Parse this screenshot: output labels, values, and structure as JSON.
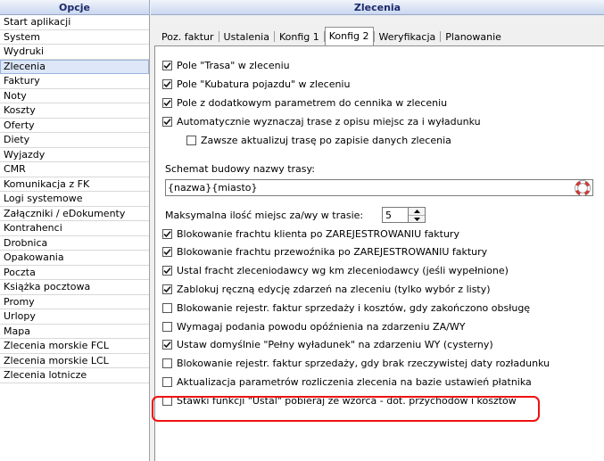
{
  "left_header": "Opcje",
  "right_header": "Zlecenia",
  "sidebar": {
    "items": [
      "Start aplikacji",
      "System",
      "Wydruki",
      "Zlecenia",
      "Faktury",
      "Noty",
      "Koszty",
      "Oferty",
      "Diety",
      "Wyjazdy",
      "CMR",
      "Komunikacja z FK",
      "Logi systemowe",
      "Załączniki / eDokumenty",
      "Kontrahenci",
      "Drobnica",
      "Opakowania",
      "Poczta",
      "Książka pocztowa",
      "Promy",
      "Urlopy",
      "Mapa",
      "Zlecenia morskie FCL",
      "Zlecenia morskie LCL",
      "Zlecenia lotnicze"
    ],
    "selected": "Zlecenia"
  },
  "tabs": [
    "Poz. faktur",
    "Ustalenia",
    "Konfig 1",
    "Konfig 2",
    "Weryfikacja",
    "Planowanie"
  ],
  "active_tab": "Konfig 2",
  "options_top": [
    {
      "label": "Pole \"Trasa\" w zleceniu",
      "checked": true
    },
    {
      "label": "Pole \"Kubatura pojazdu\" w zleceniu",
      "checked": true
    },
    {
      "label": "Pole z dodatkowym parametrem do cennika w zleceniu",
      "checked": true
    },
    {
      "label": "Automatycznie wyznaczaj trase z opisu miejsc za i wyładunku",
      "checked": true
    },
    {
      "label": "Zawsze aktualizuj trasę po zapisie danych zlecenia",
      "checked": false
    }
  ],
  "route_schema": {
    "label": "Schemat budowy nazwy trasy:",
    "value": "{nazwa}{miasto}"
  },
  "max_places": {
    "label": "Maksymalna ilość miejsc za/wy w trasie:",
    "value": "5"
  },
  "options_bottom": [
    {
      "label": "Blokowanie frachtu klienta po ZAREJESTROWANIU faktury",
      "checked": true
    },
    {
      "label": "Blokowanie frachtu przewoźnika po ZAREJESTROWANIU faktury",
      "checked": true
    },
    {
      "label": "Ustal fracht zleceniodawcy wg km zleceniodawcy (jeśli wypełnione)",
      "checked": true
    },
    {
      "label": "Zablokuj ręczną edycję zdarzeń na zleceniu (tylko wybór z listy)",
      "checked": true
    },
    {
      "label": "Blokowanie rejestr. faktur sprzedaży i kosztów, gdy zakończono obsługę",
      "checked": false
    },
    {
      "label": "Wymagaj podania powodu opóźnienia na zdarzeniu ZA/WY",
      "checked": false
    },
    {
      "label": "Ustaw domyślnie \"Pełny wyładunek\" na zdarzeniu WY (cysterny)",
      "checked": true
    },
    {
      "label": "Blokowanie rejestr. faktur sprzedaży, gdy brak rzeczywistej daty rozładunku",
      "checked": false
    },
    {
      "label": "Aktualizacja parametrów rozliczenia zlecenia na bazie ustawień płatnika",
      "checked": false
    },
    {
      "label": "Stawki funkcji \"Ustal\" pobieraj ze wzorca - dot. przychodów i kosztów",
      "checked": false
    }
  ],
  "colors": {
    "highlight": "#e11111",
    "selected_bg": "#dde7f7",
    "header_text": "#1c2a6b"
  }
}
